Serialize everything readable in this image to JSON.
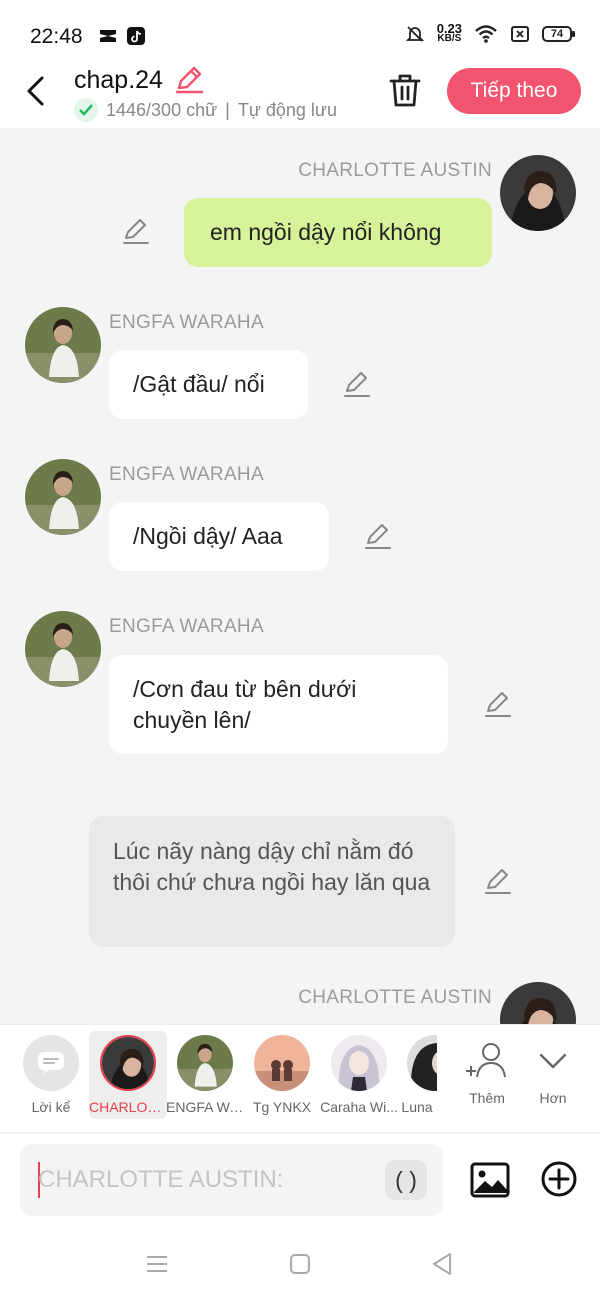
{
  "status": {
    "time": "22:48",
    "speed_value": "0.23",
    "speed_unit": "KB/S",
    "battery": "74"
  },
  "header": {
    "title": "chap.24",
    "word_count": "1446/300 chữ",
    "separator": "|",
    "autosave": "Tự động lưu",
    "next_button": "Tiếp theo"
  },
  "messages": [
    {
      "side": "right",
      "speaker": "CHARLOTTE AUSTIN",
      "text": "em ngồi dậy nổi không"
    },
    {
      "side": "left",
      "speaker": "ENGFA WARAHA",
      "text": "/Gật đầu/ nổi"
    },
    {
      "side": "left",
      "speaker": "ENGFA WARAHA",
      "text": "/Ngồi dậy/ Aaa"
    },
    {
      "side": "left",
      "speaker": "ENGFA WARAHA",
      "text": "/Cơn đau từ bên dưới chuyền lên/"
    },
    {
      "side": "narration",
      "speaker": "",
      "text": "Lúc nãy nàng dậy chỉ nằm đó thôi chứ chưa ngồi hay lăn qua"
    },
    {
      "side": "right",
      "speaker": "CHARLOTTE AUSTIN",
      "text": ""
    }
  ],
  "characters": [
    {
      "label": "Lời kể",
      "icon": "narrator-bubble-icon"
    },
    {
      "label": "CHARLOTTE AUSTIN",
      "active": true
    },
    {
      "label": "ENGFA WARAHA"
    },
    {
      "label": "Tg YNKX"
    },
    {
      "label": "Caraha Wi..."
    },
    {
      "label": "Luna"
    },
    {
      "label": "Thêm",
      "icon": "add-person-icon"
    },
    {
      "label": "Hơn",
      "icon": "chevron-down-icon"
    }
  ],
  "input": {
    "placeholder": "CHARLOTTE AUSTIN:",
    "paren_button": "( )"
  },
  "colors": {
    "accent": "#f25470",
    "right_bubble": "#d7f39a",
    "active_label": "#e8404a"
  }
}
